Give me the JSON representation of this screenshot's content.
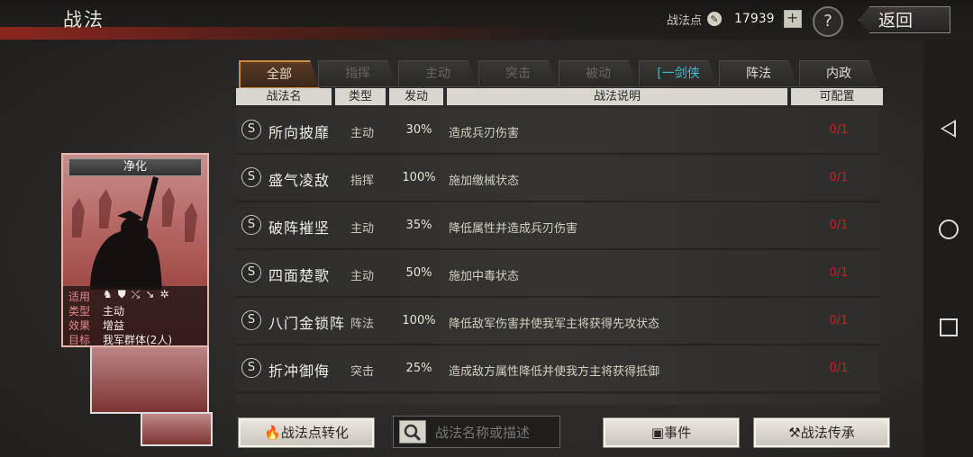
{
  "header": {
    "title": "战法",
    "points_label": "战法点",
    "points_value": "17939",
    "plus": "+",
    "help": "?",
    "back_label": "返回"
  },
  "tabs": [
    {
      "label": "全部"
    },
    {
      "label": "指挥"
    },
    {
      "label": "主动"
    },
    {
      "label": "突击"
    },
    {
      "label": "被动"
    },
    {
      "label": "[一剑侠"
    },
    {
      "label": "阵法"
    },
    {
      "label": "内政"
    }
  ],
  "columns": {
    "name": "战法名",
    "type": "类型",
    "trigger": "发动",
    "desc": "战法说明",
    "config": "可配置"
  },
  "rows": [
    {
      "grade": "S",
      "name": "所向披靡",
      "type": "主动",
      "rate": "30%",
      "desc": "造成兵刃伤害",
      "config": "0/1"
    },
    {
      "grade": "S",
      "name": "盛气凌敌",
      "type": "指挥",
      "rate": "100%",
      "desc": "施加缴械状态",
      "config": "0/1"
    },
    {
      "grade": "S",
      "name": "破阵摧坚",
      "type": "主动",
      "rate": "35%",
      "desc": "降低属性并造成兵刃伤害",
      "config": "0/1"
    },
    {
      "grade": "S",
      "name": "四面楚歌",
      "type": "主动",
      "rate": "50%",
      "desc": "施加中毒状态",
      "config": "0/1"
    },
    {
      "grade": "S",
      "name": "八门金锁阵",
      "type": "阵法",
      "rate": "100%",
      "desc": "降低敌军伤害并使我军主将获得先攻状态",
      "config": "0/1"
    },
    {
      "grade": "S",
      "name": "折冲御侮",
      "type": "突击",
      "rate": "25%",
      "desc": "造成敌方属性降低并使我方主将获得抵御",
      "config": "0/1"
    }
  ],
  "card": {
    "name": "净化",
    "applicable_label": "适用",
    "type_label": "类型",
    "type_value": "主动",
    "effect_label": "效果",
    "effect_value": "增益",
    "target_label": "目标",
    "target_value": "我军群体(2人)"
  },
  "bottom": {
    "convert_label": "战法点转化",
    "search_placeholder": "战法名称或描述",
    "events_label": "事件",
    "inherit_label": "战法传承"
  }
}
